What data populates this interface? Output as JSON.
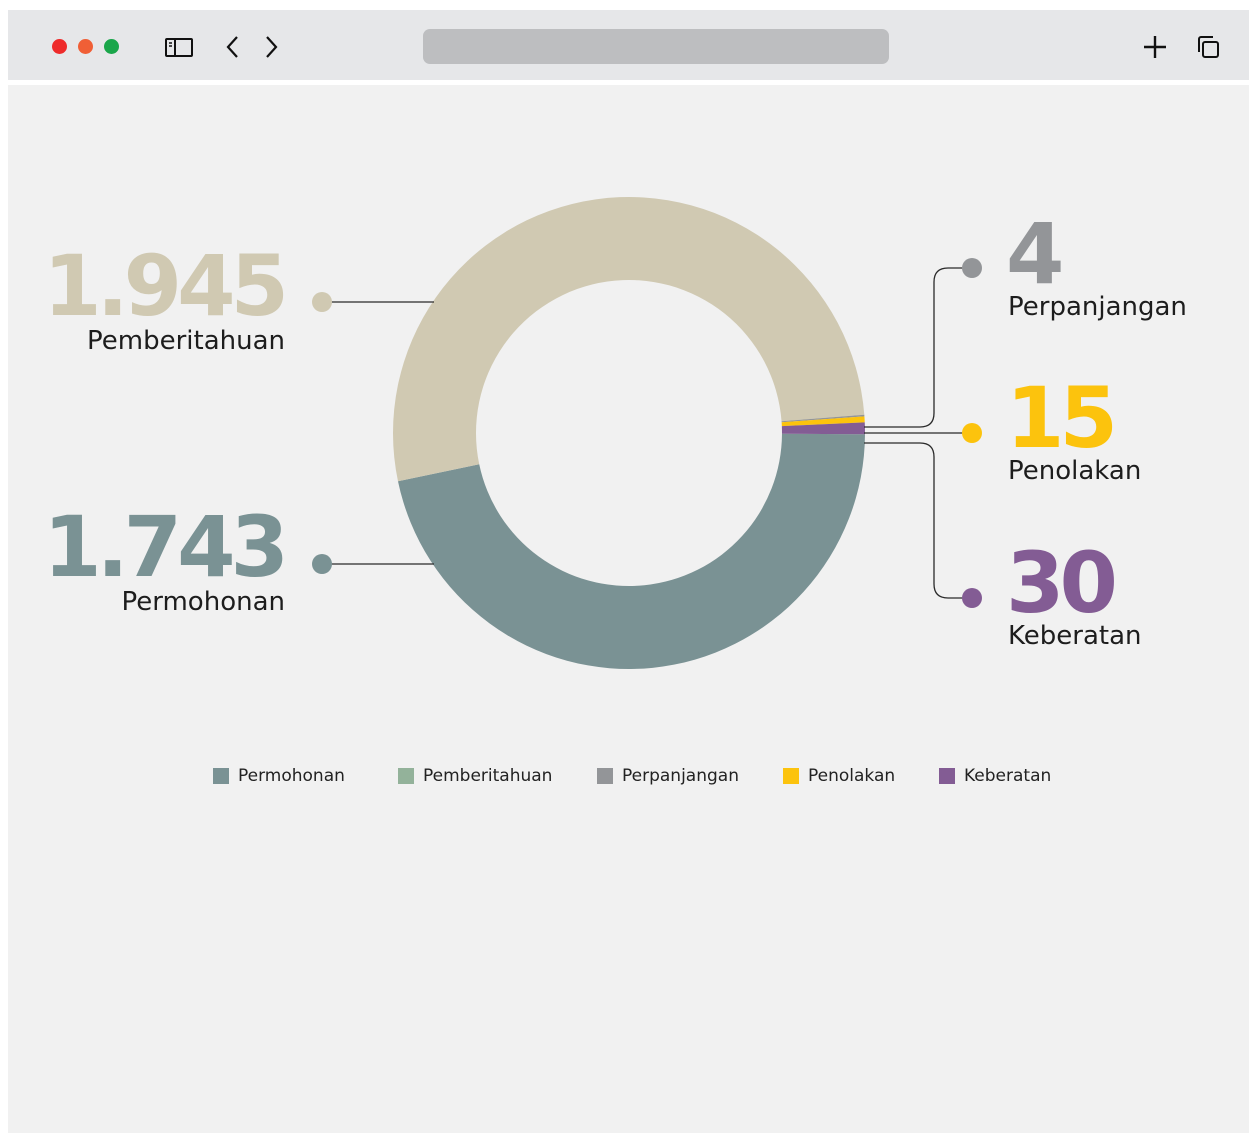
{
  "window": {
    "traffic_lights": {
      "close": "#ee2b2b",
      "minimize": "#f05f36",
      "zoom": "#1aa64a"
    },
    "toolbar_icons": [
      "sidebar-icon",
      "back-icon",
      "forward-icon",
      "new-tab-icon",
      "tabs-overview-icon"
    ]
  },
  "chart_data": {
    "type": "pie",
    "style": "donut",
    "categories": [
      "Permohonan",
      "Pemberitahuan",
      "Perpanjangan",
      "Penolakan",
      "Keberatan"
    ],
    "values": [
      1743,
      1945,
      4,
      15,
      30
    ],
    "colors": {
      "Permohonan": "#7a9294",
      "Pemberitahuan": "#d0c9b2",
      "Perpanjangan": "#939598",
      "Penolakan": "#fcc30d",
      "Keberatan": "#835c94"
    },
    "legend_colors": {
      "Permohonan": "#7a9294",
      "Pemberitahuan": "#93b29a",
      "Perpanjangan": "#939598",
      "Penolakan": "#fcc30d",
      "Keberatan": "#835c94"
    },
    "legend_position": "bottom",
    "callouts": [
      {
        "category": "Pemberitahuan",
        "value_text": "1.945",
        "label": "Pemberitahuan"
      },
      {
        "category": "Permohonan",
        "value_text": "1.743",
        "label": "Permohonan"
      },
      {
        "category": "Perpanjangan",
        "value_text": "4",
        "label": "Perpanjangan"
      },
      {
        "category": "Penolakan",
        "value_text": "15",
        "label": "Penolakan"
      },
      {
        "category": "Keberatan",
        "value_text": "30",
        "label": "Keberatan"
      }
    ],
    "title": "",
    "grid": false
  }
}
